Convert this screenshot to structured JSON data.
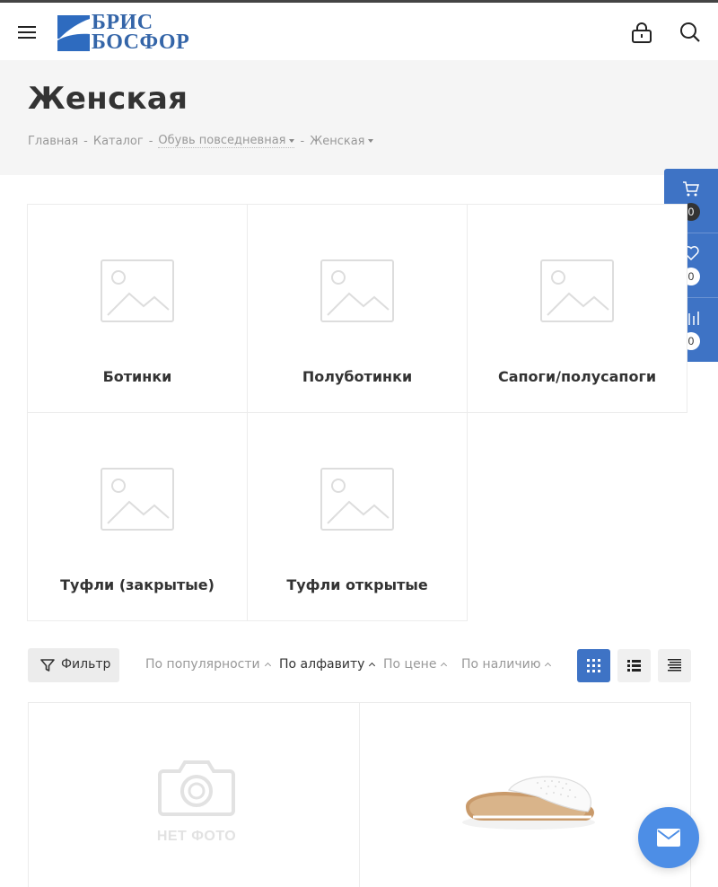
{
  "header": {
    "logo_line1": "БРИС",
    "logo_line2": "БОСФОР",
    "icons": [
      "menu-icon",
      "lock-icon",
      "search-icon"
    ]
  },
  "page": {
    "title": "Женская",
    "breadcrumbs": [
      {
        "label": "Главная",
        "dropdown": false
      },
      {
        "label": "Каталог",
        "dropdown": false
      },
      {
        "label": "Обувь повседневная",
        "dropdown": true
      },
      {
        "label": "Женская",
        "dropdown": true
      }
    ],
    "breadcrumb_separator": "-"
  },
  "side_panel": {
    "cart_count": "0",
    "wishlist_count": "0",
    "compare_count": "0"
  },
  "categories": [
    {
      "name": "Ботинки"
    },
    {
      "name": "Полуботинки"
    },
    {
      "name": "Сапоги/полусапоги"
    },
    {
      "name": "Туфли (закрытые)"
    },
    {
      "name": "Туфли открытые"
    }
  ],
  "toolbar": {
    "filter_label": "Фильтр",
    "sort_options": [
      {
        "label": "По популярности",
        "active": false
      },
      {
        "label": "По алфавиту",
        "active": true
      },
      {
        "label": "По цене",
        "active": false
      },
      {
        "label": "По наличию",
        "active": false
      }
    ],
    "views": [
      "grid-view-icon",
      "list-view-icon",
      "table-view-icon"
    ],
    "active_view": "grid"
  },
  "products": [
    {
      "image": "no-photo",
      "no_photo_text": "НЕТ ФОТО"
    },
    {
      "image": "white-perforated-slipper"
    }
  ],
  "colors": {
    "accent": "#3e73c5",
    "mail_button": "#4d8ee6",
    "logo": "#3465a8"
  }
}
